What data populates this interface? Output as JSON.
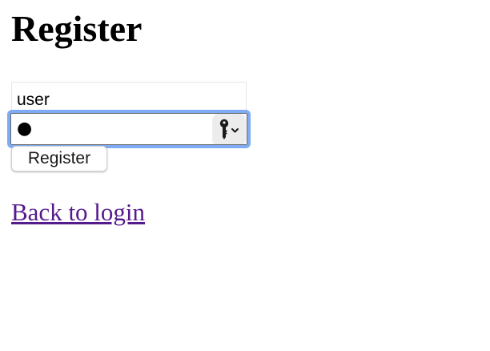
{
  "page": {
    "title": "Register"
  },
  "form": {
    "username_value": "user",
    "password_masked": "●",
    "keychain_icon": "key-icon",
    "register_label": "Register",
    "focus_ring_color": "#7eabf4"
  },
  "navigation": {
    "back_link_label": "Back to login",
    "visited_link_color": "#551a8b"
  }
}
